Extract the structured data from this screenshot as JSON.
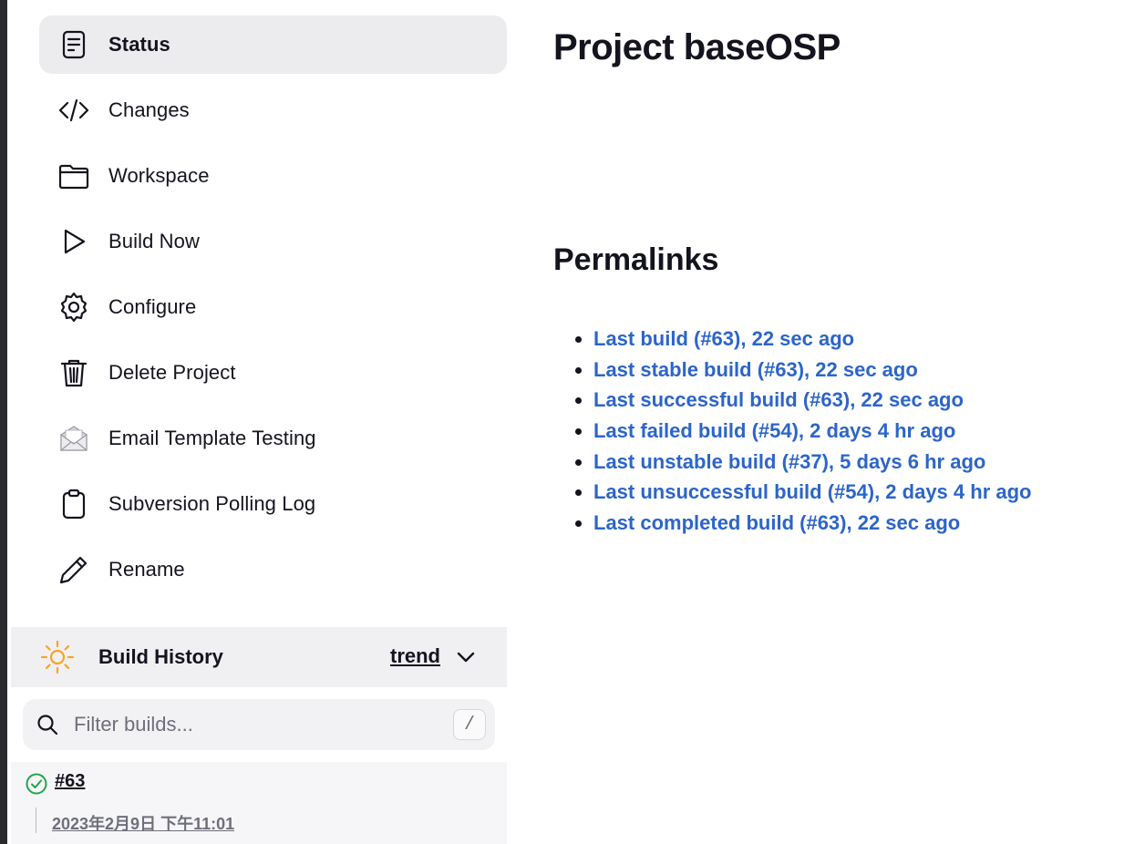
{
  "sidebar": {
    "tasks": [
      {
        "label": "Status",
        "icon": "document-icon",
        "active": true
      },
      {
        "label": "Changes",
        "icon": "code-icon"
      },
      {
        "label": "Workspace",
        "icon": "folder-icon"
      },
      {
        "label": "Build Now",
        "icon": "play-icon"
      },
      {
        "label": "Configure",
        "icon": "gear-icon"
      },
      {
        "label": "Delete Project",
        "icon": "trash-icon"
      },
      {
        "label": "Email Template Testing",
        "icon": "envelope-icon"
      },
      {
        "label": "Subversion Polling Log",
        "icon": "clipboard-icon"
      },
      {
        "label": "Rename",
        "icon": "pencil-icon"
      }
    ]
  },
  "build_history": {
    "title": "Build History",
    "trend_label": "trend",
    "filter_placeholder": "Filter builds...",
    "shortcut_key": "/",
    "builds": [
      {
        "number": "#63",
        "date": "2023年2月9日 下午11:01",
        "status": "success"
      }
    ]
  },
  "main": {
    "title": "Project baseOSP",
    "permalinks_title": "Permalinks",
    "permalinks": [
      "Last build (#63), 22 sec ago",
      "Last stable build (#63), 22 sec ago",
      "Last successful build (#63), 22 sec ago",
      "Last failed build (#54), 2 days 4 hr ago",
      "Last unstable build (#37), 5 days 6 hr ago",
      "Last unsuccessful build (#54), 2 days 4 hr ago",
      "Last completed build (#63), 22 sec ago"
    ]
  },
  "colors": {
    "link": "#2c65c9",
    "active_bg": "#ececef",
    "success": "#1ea64b",
    "sun": "#f5a623"
  }
}
